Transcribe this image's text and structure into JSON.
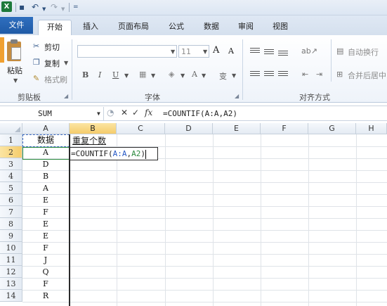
{
  "quick_access": {
    "app_icon": "X",
    "icons": [
      "save-icon",
      "undo-icon",
      "redo-icon",
      "customize-icon"
    ]
  },
  "tabs": [
    {
      "label": "文件"
    },
    {
      "label": "开始"
    },
    {
      "label": "插入"
    },
    {
      "label": "页面布局"
    },
    {
      "label": "公式"
    },
    {
      "label": "数据"
    },
    {
      "label": "审阅"
    },
    {
      "label": "视图"
    }
  ],
  "ribbon": {
    "clipboard": {
      "paste": "粘贴",
      "cut": "剪切",
      "copy": "复制",
      "format_painter": "格式刷",
      "group": "剪贴板"
    },
    "font": {
      "size": "11",
      "grow": "A",
      "shrink": "A",
      "bold": "B",
      "italic": "I",
      "underline": "U",
      "group": "字体",
      "phonetic": "变"
    },
    "alignment": {
      "wrap": "自动换行",
      "merge": "合并后居中",
      "group": "对齐方式"
    }
  },
  "formula_bar": {
    "name_box": "SUM",
    "cancel": "✕",
    "enter": "✓",
    "fx": "fx",
    "formula": "=COUNTIF(A:A,A2)"
  },
  "grid": {
    "columns": [
      "A",
      "B",
      "C",
      "D",
      "E",
      "F",
      "G",
      "H"
    ],
    "rows": [
      "1",
      "2",
      "3",
      "4",
      "5",
      "6",
      "7",
      "8",
      "9",
      "10",
      "11",
      "12",
      "13",
      "14"
    ],
    "colA": [
      "数据",
      "A",
      "D",
      "B",
      "A",
      "E",
      "F",
      "E",
      "E",
      "F",
      "J",
      "Q",
      "F",
      "R"
    ],
    "b1": "重复个数",
    "b2_parts": [
      "=COUNTIF(",
      "A:A",
      ",",
      "A2",
      ")"
    ]
  }
}
